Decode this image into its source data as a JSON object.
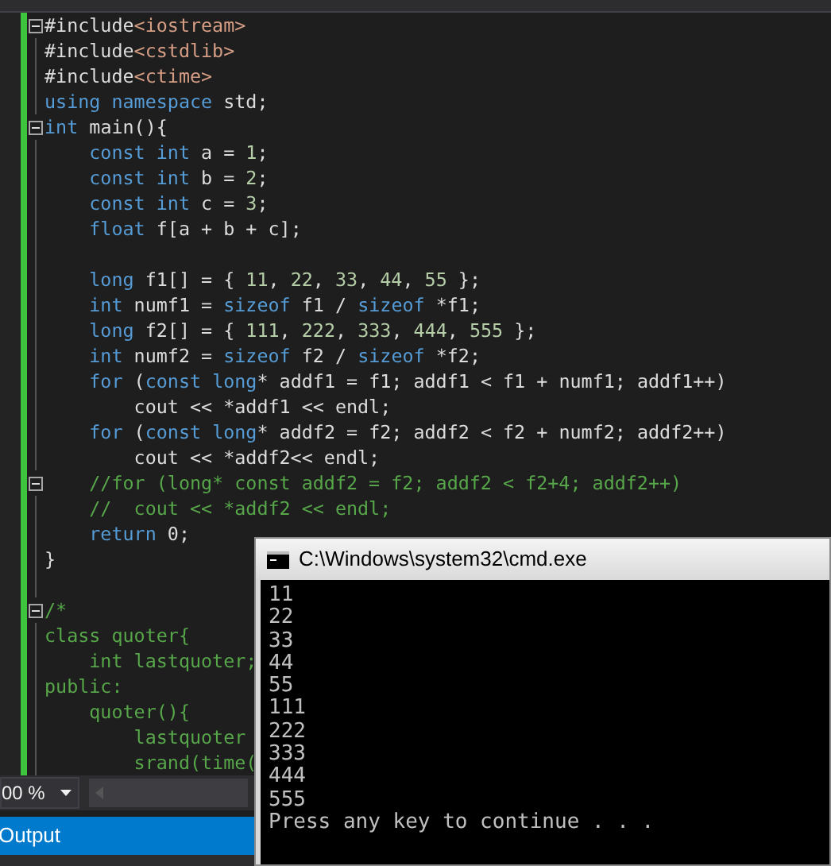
{
  "editor": {
    "lines": [
      {
        "fold": true,
        "segments": [
          {
            "text": "#include",
            "kind": "plain"
          },
          {
            "text": "<iostream>",
            "kind": "include"
          }
        ]
      },
      {
        "fold": false,
        "segments": [
          {
            "text": "#include",
            "kind": "plain"
          },
          {
            "text": "<cstdlib>",
            "kind": "include"
          }
        ]
      },
      {
        "fold": false,
        "segments": [
          {
            "text": "#include",
            "kind": "plain"
          },
          {
            "text": "<ctime>",
            "kind": "include"
          }
        ]
      },
      {
        "fold": false,
        "segments": [
          {
            "text": "using namespace",
            "kind": "keyword"
          },
          {
            "text": " std;",
            "kind": "plain"
          }
        ]
      },
      {
        "fold": true,
        "segments": [
          {
            "text": "int",
            "kind": "keyword"
          },
          {
            "text": " main(){",
            "kind": "plain"
          }
        ]
      },
      {
        "fold": false,
        "segments": [
          {
            "text": "    const int",
            "kind": "keyword"
          },
          {
            "text": " a = ",
            "kind": "plain"
          },
          {
            "text": "1",
            "kind": "number"
          },
          {
            "text": ";",
            "kind": "plain"
          }
        ]
      },
      {
        "fold": false,
        "segments": [
          {
            "text": "    const int",
            "kind": "keyword"
          },
          {
            "text": " b = ",
            "kind": "plain"
          },
          {
            "text": "2",
            "kind": "number"
          },
          {
            "text": ";",
            "kind": "plain"
          }
        ]
      },
      {
        "fold": false,
        "segments": [
          {
            "text": "    const int",
            "kind": "keyword"
          },
          {
            "text": " c = ",
            "kind": "plain"
          },
          {
            "text": "3",
            "kind": "number"
          },
          {
            "text": ";",
            "kind": "plain"
          }
        ]
      },
      {
        "fold": false,
        "segments": [
          {
            "text": "    float",
            "kind": "keyword"
          },
          {
            "text": " f[a + b + c];",
            "kind": "plain"
          }
        ]
      },
      {
        "fold": false
      },
      {
        "fold": false,
        "segments": [
          {
            "text": "    long",
            "kind": "keyword"
          },
          {
            "text": " f1[] = { ",
            "kind": "plain"
          },
          {
            "text": "11",
            "kind": "number"
          },
          {
            "text": ", ",
            "kind": "plain"
          },
          {
            "text": "22",
            "kind": "number"
          },
          {
            "text": ", ",
            "kind": "plain"
          },
          {
            "text": "33",
            "kind": "number"
          },
          {
            "text": ", ",
            "kind": "plain"
          },
          {
            "text": "44",
            "kind": "number"
          },
          {
            "text": ", ",
            "kind": "plain"
          },
          {
            "text": "55",
            "kind": "number"
          },
          {
            "text": " };",
            "kind": "plain"
          }
        ]
      },
      {
        "fold": false,
        "segments": [
          {
            "text": "    int",
            "kind": "keyword"
          },
          {
            "text": " numf1 = ",
            "kind": "plain"
          },
          {
            "text": "sizeof",
            "kind": "keyword"
          },
          {
            "text": " f1 / ",
            "kind": "plain"
          },
          {
            "text": "sizeof",
            "kind": "keyword"
          },
          {
            "text": " *f1;",
            "kind": "plain"
          }
        ]
      },
      {
        "fold": false,
        "segments": [
          {
            "text": "    long",
            "kind": "keyword"
          },
          {
            "text": " f2[] = { ",
            "kind": "plain"
          },
          {
            "text": "111",
            "kind": "number"
          },
          {
            "text": ", ",
            "kind": "plain"
          },
          {
            "text": "222",
            "kind": "number"
          },
          {
            "text": ", ",
            "kind": "plain"
          },
          {
            "text": "333",
            "kind": "number"
          },
          {
            "text": ", ",
            "kind": "plain"
          },
          {
            "text": "444",
            "kind": "number"
          },
          {
            "text": ", ",
            "kind": "plain"
          },
          {
            "text": "555",
            "kind": "number"
          },
          {
            "text": " };",
            "kind": "plain"
          }
        ]
      },
      {
        "fold": false,
        "segments": [
          {
            "text": "    int",
            "kind": "keyword"
          },
          {
            "text": " numf2 = ",
            "kind": "plain"
          },
          {
            "text": "sizeof",
            "kind": "keyword"
          },
          {
            "text": " f2 / ",
            "kind": "plain"
          },
          {
            "text": "sizeof",
            "kind": "keyword"
          },
          {
            "text": " *f2;",
            "kind": "plain"
          }
        ]
      },
      {
        "fold": false,
        "segments": [
          {
            "text": "    for",
            "kind": "keyword"
          },
          {
            "text": " (",
            "kind": "plain"
          },
          {
            "text": "const long",
            "kind": "keyword"
          },
          {
            "text": "* addf1 = f1; addf1 < f1 + numf1; addf1++)",
            "kind": "plain"
          }
        ]
      },
      {
        "fold": false,
        "segments": [
          {
            "text": "        cout << *addf1 << endl;",
            "kind": "plain"
          }
        ]
      },
      {
        "fold": false,
        "segments": [
          {
            "text": "    for",
            "kind": "keyword"
          },
          {
            "text": " (",
            "kind": "plain"
          },
          {
            "text": "const long",
            "kind": "keyword"
          },
          {
            "text": "* addf2 = f2; addf2 < f2 + numf2; addf2++)",
            "kind": "plain"
          }
        ]
      },
      {
        "fold": false,
        "segments": [
          {
            "text": "        cout << *addf2<< endl;",
            "kind": "plain"
          }
        ]
      },
      {
        "fold": true,
        "segments": [
          {
            "text": "    //for (long* const addf2 = f2; addf2 < f2+4; addf2++)",
            "kind": "comment"
          }
        ]
      },
      {
        "fold": false,
        "segments": [
          {
            "text": "    //  cout << *addf2 << endl;",
            "kind": "comment"
          }
        ]
      },
      {
        "fold": false,
        "segments": [
          {
            "text": "    return",
            "kind": "keyword"
          },
          {
            "text": " 0;",
            "kind": "plain"
          }
        ]
      },
      {
        "fold": false,
        "segments": [
          {
            "text": "}",
            "kind": "plain"
          }
        ]
      },
      {
        "fold": false
      },
      {
        "fold": true,
        "segments": [
          {
            "text": "/*",
            "kind": "comment"
          }
        ]
      },
      {
        "fold": false,
        "segments": [
          {
            "text": "class quoter{",
            "kind": "comment"
          }
        ]
      },
      {
        "fold": false,
        "segments": [
          {
            "text": "    int lastquoter;",
            "kind": "comment"
          }
        ]
      },
      {
        "fold": false,
        "segments": [
          {
            "text": "public:",
            "kind": "comment"
          }
        ]
      },
      {
        "fold": false,
        "segments": [
          {
            "text": "    quoter(){",
            "kind": "comment"
          }
        ]
      },
      {
        "fold": false,
        "segments": [
          {
            "text": "        lastquoter",
            "kind": "comment"
          }
        ]
      },
      {
        "fold": false,
        "segments": [
          {
            "text": "        srand(time(",
            "kind": "comment"
          }
        ]
      }
    ]
  },
  "zoom": {
    "value": "00 %"
  },
  "output_panel": {
    "title": "Output"
  },
  "console": {
    "title": "C:\\Windows\\system32\\cmd.exe",
    "lines": [
      "11",
      "22",
      "33",
      "44",
      "55",
      "111",
      "222",
      "333",
      "444",
      "555",
      "Press any key to continue . . ."
    ]
  }
}
